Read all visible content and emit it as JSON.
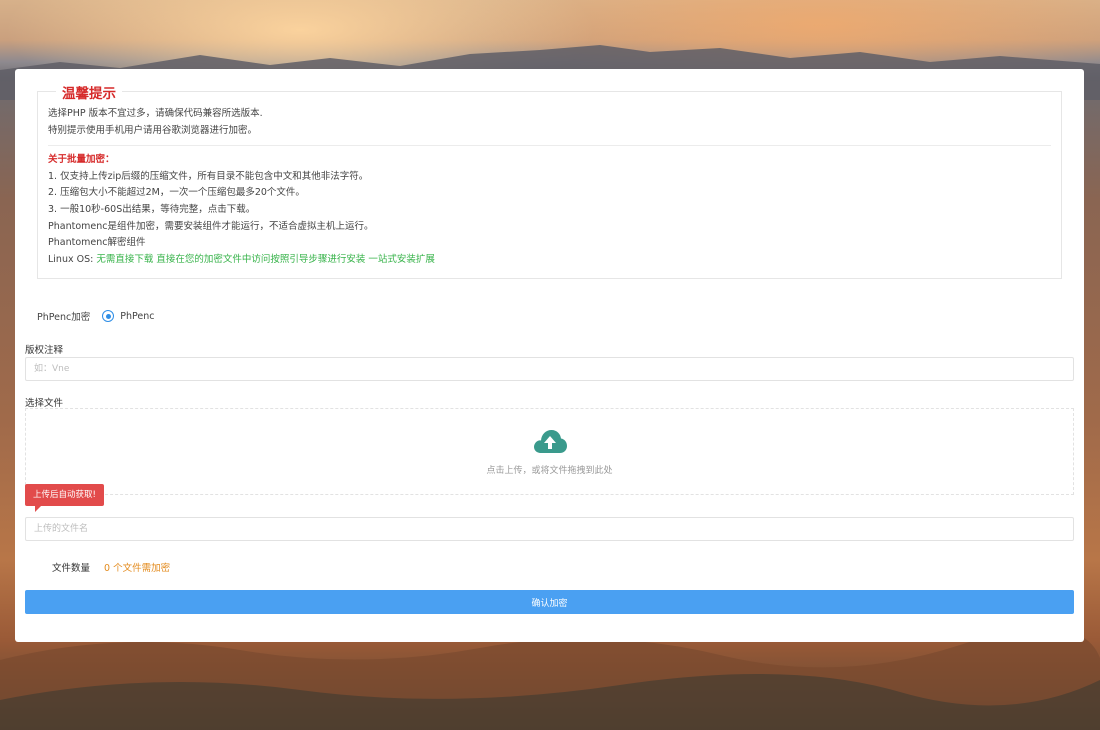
{
  "notice": {
    "title": "温馨提示",
    "line1": "选择PHP 版本不宜过多，请确保代码兼容所选版本.",
    "line2": "特别提示使用手机用户请用谷歌浏览器进行加密。",
    "batch_title": "关于批量加密：",
    "items": [
      "1. 仅支持上传zip后缀的压缩文件，所有目录不能包含中文和其他非法字符。",
      "2. 压缩包大小不能超过2M，一次一个压缩包最多20个文件。",
      "3. 一般10秒-60S出结果，等待完整，点击下载。",
      "Phantomenc是组件加密，需要安装组件才能运行，不适合虚拟主机上运行。",
      "Phantomenc解密组件"
    ],
    "linux_label": "Linux OS: ",
    "linux_link": "无需直接下载 直接在您的加密文件中访问按照引导步骤进行安装 一站式安装扩展"
  },
  "encrypt": {
    "label": "PhPenc加密",
    "option": "PhPenc"
  },
  "copyright": {
    "label": "版权注释",
    "placeholder": "如：Vne"
  },
  "file": {
    "label": "选择文件",
    "upload_text": "点击上传，或将文件拖拽到此处",
    "tip": "上传后自动获取!",
    "filename_placeholder": "上传的文件名"
  },
  "count": {
    "label": "文件数量",
    "value": "0 个文件需加密"
  },
  "submit_label": "确认加密",
  "colors": {
    "accent": "#4aa0f2",
    "notice_red": "#d62a2a",
    "link_green": "#37b34a",
    "count_orange": "#e38b1e",
    "upload_icon": "#3a9a8c"
  }
}
